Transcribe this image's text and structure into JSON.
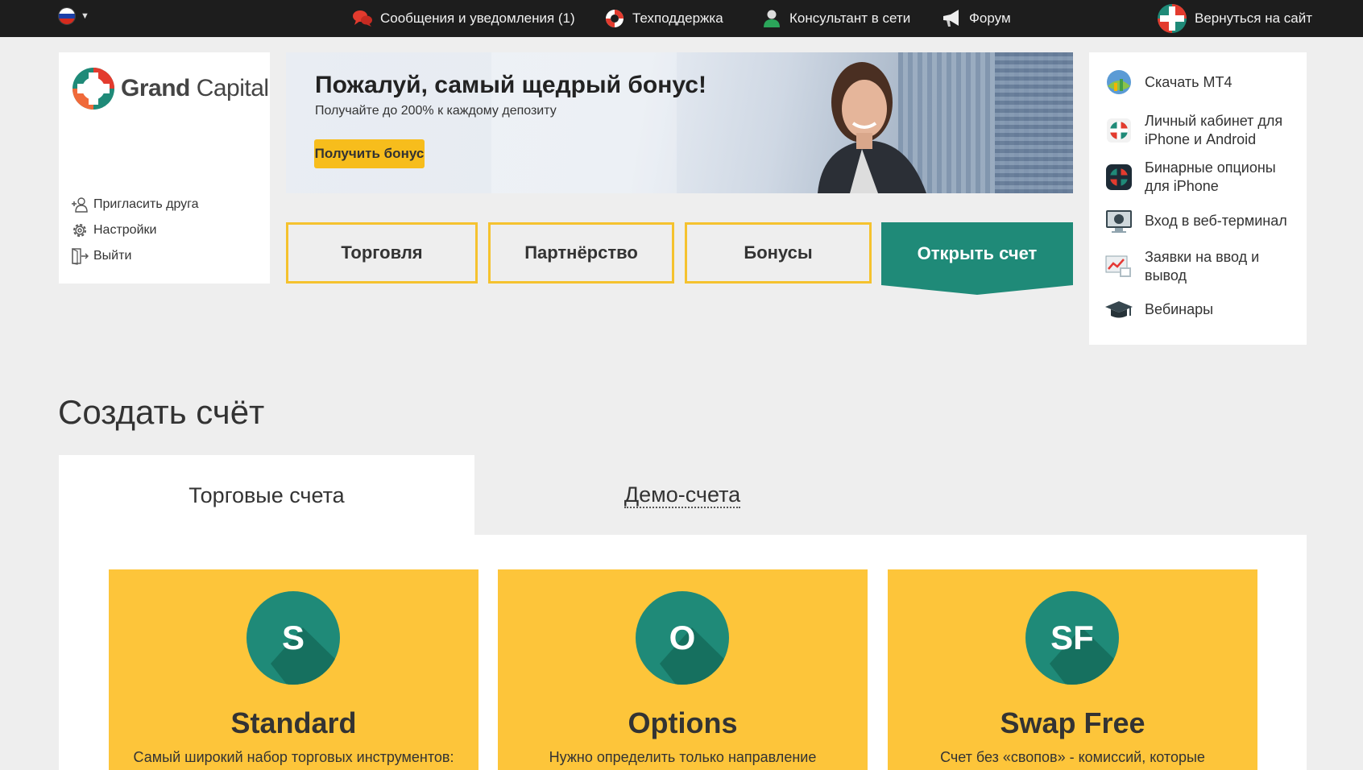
{
  "topbar": {
    "messages": "Сообщения и уведомления (1)",
    "support": "Техподдержка",
    "consultant": "Консультант в сети",
    "forum": "Форум",
    "back_to_site": "Вернуться на сайт"
  },
  "logo": {
    "bold": "Grand",
    "regular": "Capital"
  },
  "left_links": [
    {
      "label": "Пригласить друга",
      "icon": "invite-user-icon"
    },
    {
      "label": "Настройки",
      "icon": "gear-icon"
    },
    {
      "label": "Выйти",
      "icon": "logout-icon"
    }
  ],
  "banner": {
    "title": "Пожалуй, самый щедрый бонус!",
    "subtitle": "Получайте до 200% к каждому депозиту",
    "button": "Получить бонус"
  },
  "nav": {
    "trading": "Торговля",
    "partnership": "Партнёрство",
    "bonuses": "Бонусы",
    "open_account": "Открыть счет"
  },
  "right_links": [
    {
      "label": "Скачать MT4",
      "icon": "mt4-icon"
    },
    {
      "label": "Личный кабинет для iPhone и Android",
      "icon": "mobile-app-icon"
    },
    {
      "label": "Бинарные опционы для iPhone",
      "icon": "binary-options-icon"
    },
    {
      "label": "Вход в веб-терминал",
      "icon": "web-terminal-icon"
    },
    {
      "label": "Заявки на ввод и вывод",
      "icon": "deposit-withdraw-icon"
    },
    {
      "label": "Вебинары",
      "icon": "graduation-cap-icon"
    }
  ],
  "create": {
    "title": "Создать счёт",
    "tab_trading": "Торговые счета",
    "tab_demo": "Демо-счета"
  },
  "accounts": [
    {
      "letters": "S",
      "title": "Standard",
      "desc": "Самый широкий набор торговых инструментов:"
    },
    {
      "letters": "O",
      "title": "Options",
      "desc": "Нужно определить только направление"
    },
    {
      "letters": "SF",
      "title": "Swap Free",
      "desc": "Счет без «свопов» - комиссий, которые"
    }
  ],
  "colors": {
    "topbar": "#1d1d1d",
    "accent_yellow": "#fdc53a",
    "accent_teal": "#1f8a78",
    "background": "#eeeeee"
  }
}
